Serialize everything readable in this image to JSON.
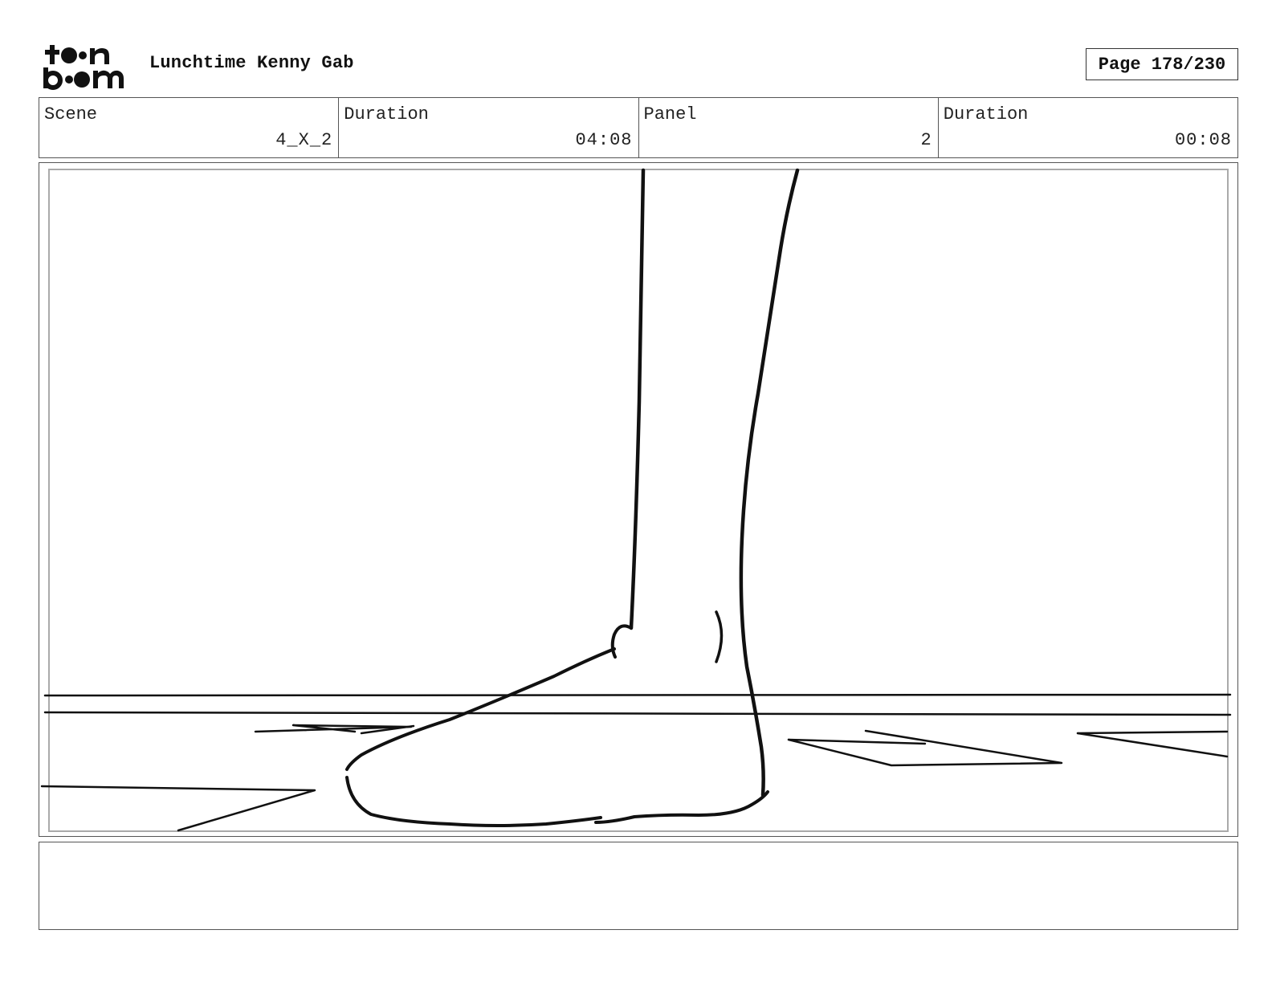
{
  "header": {
    "logo_text": "toon boom",
    "project_title": "Lunchtime Kenny Gab",
    "page_label": "Page 178/230"
  },
  "info": {
    "scene_label": "Scene",
    "scene_value": "4_X_2",
    "scene_duration_label": "Duration",
    "scene_duration_value": "04:08",
    "panel_label": "Panel",
    "panel_value": "2",
    "panel_duration_label": "Duration",
    "panel_duration_value": "00:08"
  },
  "panel": {
    "drawing_icon": "sketch-foot-standing-on-floor"
  },
  "notes": {
    "text": ""
  }
}
